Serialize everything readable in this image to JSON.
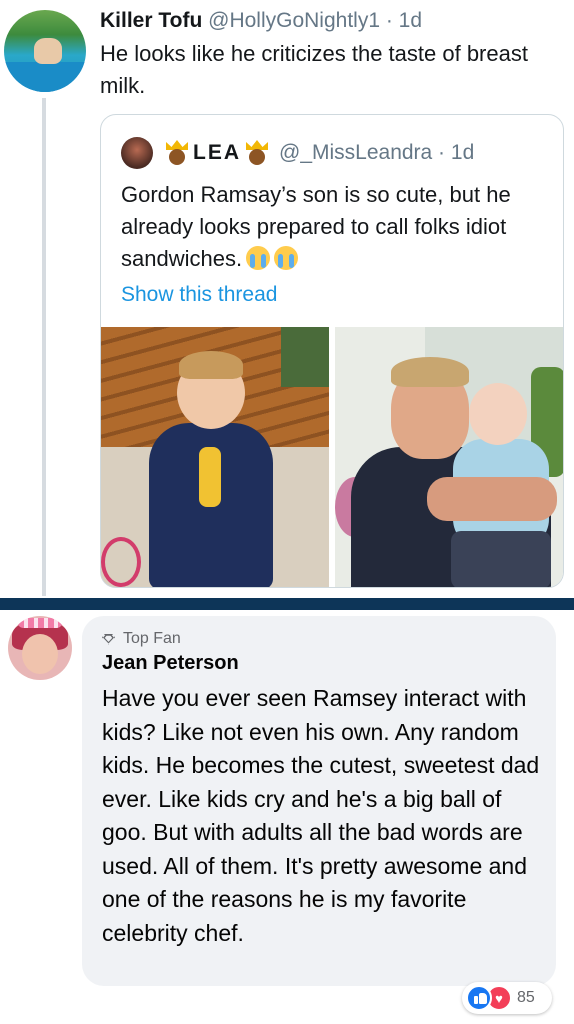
{
  "tweet": {
    "author_name": "Killer Tofu",
    "handle_time": "@HollyGoNightly1 · 1d",
    "text": "He looks like he criticizes the taste of breast milk.",
    "quoted": {
      "display_name": "LEA",
      "handle_time": "@_MissLeandra · 1d",
      "text": "Gordon Ramsay’s son is so cute, but he already looks prepared to call folks idiot sandwiches.",
      "emojis": [
        "loudly-crying-face-icon",
        "loudly-crying-face-icon"
      ],
      "show_thread_label": "Show this thread",
      "link_color": "#1b95e0"
    }
  },
  "comment": {
    "badge_label": "Top Fan",
    "author": "Jean Peterson",
    "text": "Have you ever seen Ramsey interact with kids? Like not even his own. Any random kids. He becomes the cutest, sweetest dad ever. Like kids cry and he's a big ball of goo. But with adults all the bad words are used. All of them. It's pretty awesome and one of the reasons he is my favorite celebrity chef.",
    "reactions": {
      "icons": [
        "like-icon",
        "love-icon"
      ],
      "count": "85"
    }
  },
  "colors": {
    "divider": "#0d3558",
    "bubble": "#f0f2f5",
    "like": "#1877f2",
    "love": "#f33e58"
  }
}
